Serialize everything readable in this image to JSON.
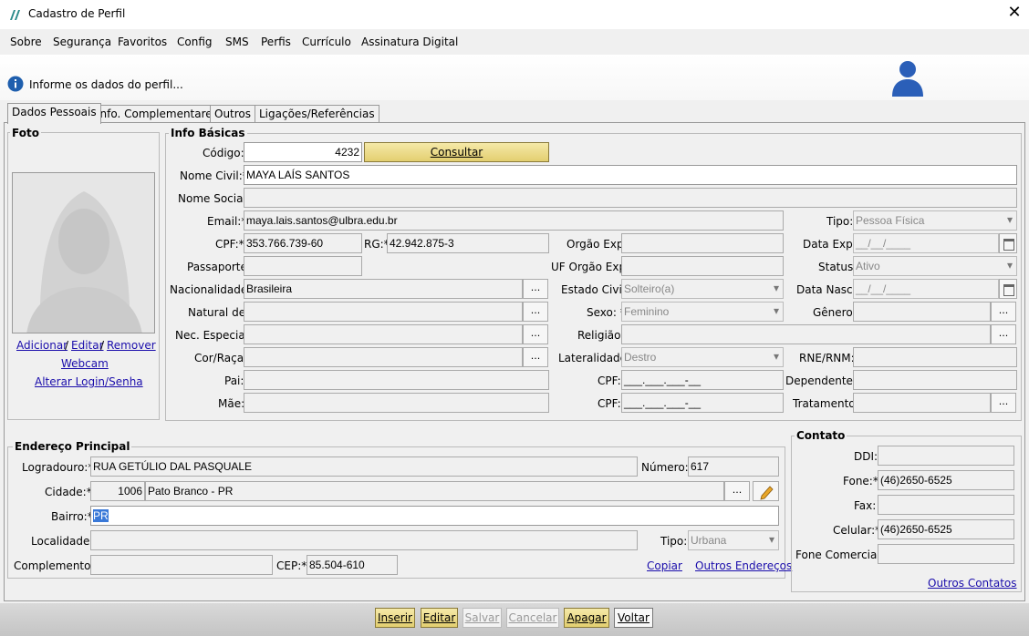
{
  "window": {
    "title": "Cadastro de Perfil",
    "close": "✕"
  },
  "menu": [
    "Sobre",
    "Segurança",
    "Favoritos",
    "Config",
    "SMS",
    "Perfis",
    "Currículo",
    "Assinatura Digital"
  ],
  "info": {
    "message": "Informe os dados do perfil..."
  },
  "tabs": [
    "Dados Pessoais",
    "Info. Complementares",
    "Outros",
    "Ligações/Referências"
  ],
  "foto": {
    "title": "Foto",
    "adicionar": "Adicionar",
    "editar": "Editar",
    "remover": "Remover",
    "sep": "/",
    "webcam": "Webcam",
    "alterar_login": "Alterar Login/Senha"
  },
  "info_basicas": {
    "title": "Info Básicas",
    "codigo_label": "Código:",
    "codigo": "4232",
    "consultar": "Consultar",
    "nome_civil_label": "Nome Civil:*",
    "nome_civil": "MAYA LAÍS SANTOS",
    "nome_social_label": "Nome Social:",
    "nome_social": "",
    "email_label": "Email:*",
    "email": "maya.lais.santos@ulbra.edu.br",
    "tipo_label": "Tipo:",
    "tipo": "Pessoa Física",
    "cpf_label": "CPF:*",
    "cpf": "353.766.739-60",
    "rg_label": "RG:*",
    "rg": "42.942.875-3",
    "orgao_exp_label": "Orgão Exp:",
    "orgao_exp": "",
    "data_exp_label": "Data Exp.:",
    "data_exp": "__/__/____",
    "passaporte_label": "Passaporte:",
    "passaporte": "",
    "uf_orgao_label": "UF Orgão Exp:",
    "uf_orgao": "",
    "status_label": "Status:",
    "status": "Ativo",
    "nacionalidade_label": "Nacionalidade:",
    "nacionalidade": "Brasileira",
    "estado_civil_label": "Estado Civil:",
    "estado_civil": "Solteiro(a)",
    "data_nasc_label": "Data Nasc.:",
    "data_nasc": "__/__/____",
    "natural_label": "Natural de:",
    "natural": "",
    "sexo_label": "Sexo: *",
    "sexo": "Feminino",
    "genero_label": "Gênero:",
    "genero": "",
    "nec_label": "Nec. Especial:",
    "nec": "",
    "religiao_label": "Religião:",
    "religiao": "",
    "cor_label": "Cor/Raça:",
    "cor": "",
    "lateralidade_label": "Lateralidade:",
    "lateralidade": "Destro",
    "rne_label": "RNE/RNM:",
    "rne": "",
    "pai_label": "Pai:",
    "pai": "",
    "cpf_pai_label": "CPF:",
    "cpf_pai": "___.___.___-__",
    "dependentes_label": "Dependentes:",
    "dependentes": "",
    "mae_label": "Mãe:",
    "mae": "",
    "cpf_mae_label": "CPF:",
    "cpf_mae": "___.___.___-__",
    "tratamento_label": "Tratamento:",
    "tratamento": "",
    "dots": "..."
  },
  "endereco": {
    "title": "Endereço Principal",
    "logradouro_label": "Logradouro:*",
    "logradouro": "RUA GETÚLIO DAL PASQUALE",
    "numero_label": "Número:",
    "numero": "617",
    "cidade_label": "Cidade:*",
    "cidade_cod": "1006",
    "cidade": "Pato Branco - PR",
    "bairro_label": "Bairro:*",
    "bairro": "PR",
    "localidade_label": "Localidade:",
    "localidade": "",
    "tipo_label": "Tipo:",
    "tipo": "Urbana",
    "complemento_label": "Complemento:",
    "complemento": "",
    "cep_label": "CEP:*",
    "cep": "85.504-610",
    "copiar": "Copiar",
    "outros_enderecos": "Outros Endereços"
  },
  "contato": {
    "title": "Contato",
    "ddi_label": "DDI:",
    "ddi": "",
    "fone_label": "Fone:*",
    "fone": "(46)2650-6525",
    "fax_label": "Fax:",
    "fax": "",
    "celular_label": "Celular:*",
    "celular": "(46)2650-6525",
    "fone_comercial_label": "Fone Comercial:",
    "fone_comercial": "",
    "outros_contatos": "Outros Contatos"
  },
  "buttons": {
    "inserir": "Inserir",
    "editar": "Editar",
    "salvar": "Salvar",
    "cancelar": "Cancelar",
    "apagar": "Apagar",
    "voltar": "Voltar"
  }
}
